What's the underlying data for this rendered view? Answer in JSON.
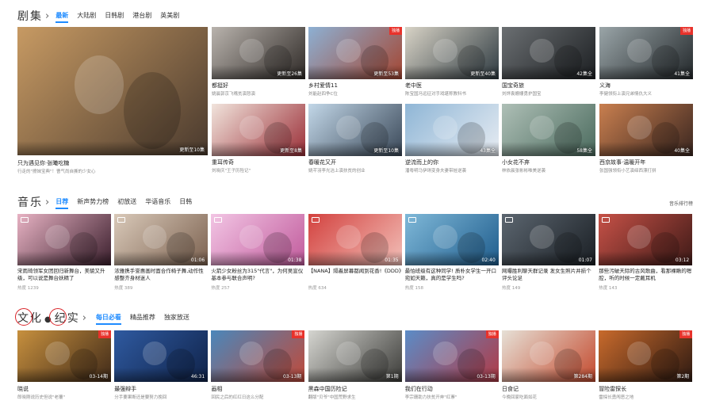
{
  "drama": {
    "title": "剧集",
    "tabs": [
      {
        "label": "最新",
        "active": true
      },
      {
        "label": "大陆剧"
      },
      {
        "label": "日韩剧"
      },
      {
        "label": "港台剧"
      },
      {
        "label": "英美剧"
      }
    ],
    "featured": {
      "title": "只为遇见你·张曦吃糖",
      "subtitle": "行走的\"撩妹宝典\"！曹气尚自撕的少女心",
      "episode": "更新至10集",
      "colors": [
        "#c79a63",
        "#4a3a2e"
      ]
    },
    "cards": [
      {
        "title": "都挺好",
        "subtitle": "姚晨郭京飞嘴贫演怒演",
        "episode": "更新至26集",
        "colors": [
          "#b9b3ad",
          "#2f2a27"
        ]
      },
      {
        "title": "乡村爱情11",
        "subtitle": "刘能赵四争C位",
        "episode": "更新至53集",
        "badge": "独播",
        "colors": [
          "#8db0d3",
          "#a44632"
        ]
      },
      {
        "title": "老中医",
        "subtitle": "陈宝国冯远征对手戏堪称教科书",
        "episode": "更新至40集",
        "colors": [
          "#d8d3c6",
          "#2e3a41"
        ]
      },
      {
        "title": "国宝奇旅",
        "subtitle": "刘烨袁姗姗勇护国宝",
        "episode": "42集全",
        "colors": [
          "#6b6f72",
          "#1c1f22"
        ]
      },
      {
        "title": "义海",
        "subtitle": "李健领衔上演兄弟情仇大义",
        "episode": "41集全",
        "badge": "独播",
        "colors": [
          "#9aa5a8",
          "#22272a"
        ]
      },
      {
        "title": "重耳传奇",
        "subtitle": "刘晓庆\"王子历险记\"",
        "episode": "更新至8集",
        "colors": [
          "#f1e4dc",
          "#9b2f38"
        ]
      },
      {
        "title": "春暖花又开",
        "subtitle": "姚芊羽李光洁上演扶贫的创业",
        "episode": "更新至10集",
        "colors": [
          "#c2d7e8",
          "#3a4858"
        ]
      },
      {
        "title": "逆流而上的你",
        "subtitle": "潘粤明马伊琍变身夫妻带娃逆袭",
        "episode": "43集全",
        "colors": [
          "#8fb6d6",
          "#e7ecf2"
        ]
      },
      {
        "title": "小女花不弃",
        "subtitle": "林依晨张彬彬唯美逆袭",
        "episode": "58集全",
        "colors": [
          "#aebfb6",
          "#4b6b5e"
        ]
      },
      {
        "title": "西京故事·温暖开年",
        "subtitle": "张国强领衔小艺演绎西漂打拼",
        "episode": "40集全",
        "colors": [
          "#c97f4f",
          "#3a2620"
        ]
      }
    ]
  },
  "music": {
    "title": "音乐",
    "tabs": [
      {
        "label": "日荐",
        "active": true
      },
      {
        "label": "新声势力榜"
      },
      {
        "label": "初放送"
      },
      {
        "label": "华语音乐"
      },
      {
        "label": "日韩"
      }
    ],
    "rank_link": "音乐排行榜",
    "cards": [
      {
        "title": "宋雨琦领军女团回归新舞台，美貌又升级，可以说是舞台妖精了",
        "plays": "热度 1239",
        "colors": [
          "#e7b2c3",
          "#3b1f2d"
        ]
      },
      {
        "title": "浓雅携手誉惠画时面合作椅子舞,动作性感整齐身材迷人",
        "plays": "热度 389",
        "duration": "01:06",
        "colors": [
          "#d9c9b9",
          "#7c6250"
        ]
      },
      {
        "title": "火箭少女粉丝为315\"代言\"，为何吴宣仪基本参与联合声明?",
        "plays": "热度 257",
        "duration": "01:38",
        "colors": [
          "#f2c5e4",
          "#c15b9c"
        ]
      },
      {
        "title": "【NANA】隔着屏幕都闻到花香!《DDD》",
        "plays": "热度 634",
        "duration": "01:35",
        "colors": [
          "#d3423f",
          "#f2bfb8"
        ]
      },
      {
        "title": "最怕班级有这种同学! 质朴女学生一开口宛如天籁，真的是学生吗?",
        "plays": "热度 158",
        "duration": "02:40",
        "colors": [
          "#7fb8d8",
          "#1f5d8d"
        ]
      },
      {
        "title": "网曝胜利聊天群记录 发女生照片并损个评头论足",
        "plays": "热度 149",
        "duration": "01:07",
        "colors": [
          "#5c6670",
          "#1a1f24"
        ]
      },
      {
        "title": "那些污破天际的古风歌曲，看那裸瞅的嗯腔，听的时候一定戴耳机",
        "plays": "热度 143",
        "duration": "03:12",
        "colors": [
          "#c65147",
          "#3e1a17"
        ]
      }
    ]
  },
  "documentary": {
    "title_parts": [
      "文化",
      "纪实"
    ],
    "dot": "●",
    "tabs": [
      {
        "label": "每日必看",
        "active": true
      },
      {
        "label": "精品推荐"
      },
      {
        "label": "独家放送"
      }
    ],
    "cards": [
      {
        "title": "晓说",
        "subtitle": "郎晓刚说历史但说\"老覆\"",
        "episode": "03-14期",
        "badge": "独播",
        "colors": [
          "#c7903e",
          "#402a19"
        ]
      },
      {
        "title": "最强辩手",
        "subtitle": "分手要果断还是要努力挽回",
        "episode": "46:31",
        "colors": [
          "#2f5aa0",
          "#10234a"
        ]
      },
      {
        "title": "画相",
        "subtitle": "回民之后的红红日这么分配",
        "episode": "03-13期",
        "badge": "独播",
        "colors": [
          "#4a87bb",
          "#c04a3a"
        ]
      },
      {
        "title": "黑森中国历险记",
        "subtitle": "翻版\"贝爷\"中国荒野求生",
        "episode": "第1期",
        "colors": [
          "#d5d5d0",
          "#3b3b38"
        ]
      },
      {
        "title": "我们在行动",
        "subtitle": "李宗珊助力扶贫开奔\"红寨\"",
        "episode": "03-13期",
        "badge": "独播",
        "colors": [
          "#5b8cc7",
          "#b13a46"
        ]
      },
      {
        "title": "日食记",
        "subtitle": "今晚回家吃面如花",
        "episode": "第284期",
        "colors": [
          "#e6e0d6",
          "#c44a2e"
        ]
      },
      {
        "title": "冒险雷探长",
        "subtitle": "雷探长勇闯恶之地",
        "episode": "第2期",
        "badge": "独播",
        "colors": [
          "#c86a2c",
          "#2e1a12"
        ]
      }
    ]
  },
  "colors": {
    "accent": "#1e8bff",
    "badge": "#e8322b",
    "annotation_circle": "#d9252a"
  }
}
